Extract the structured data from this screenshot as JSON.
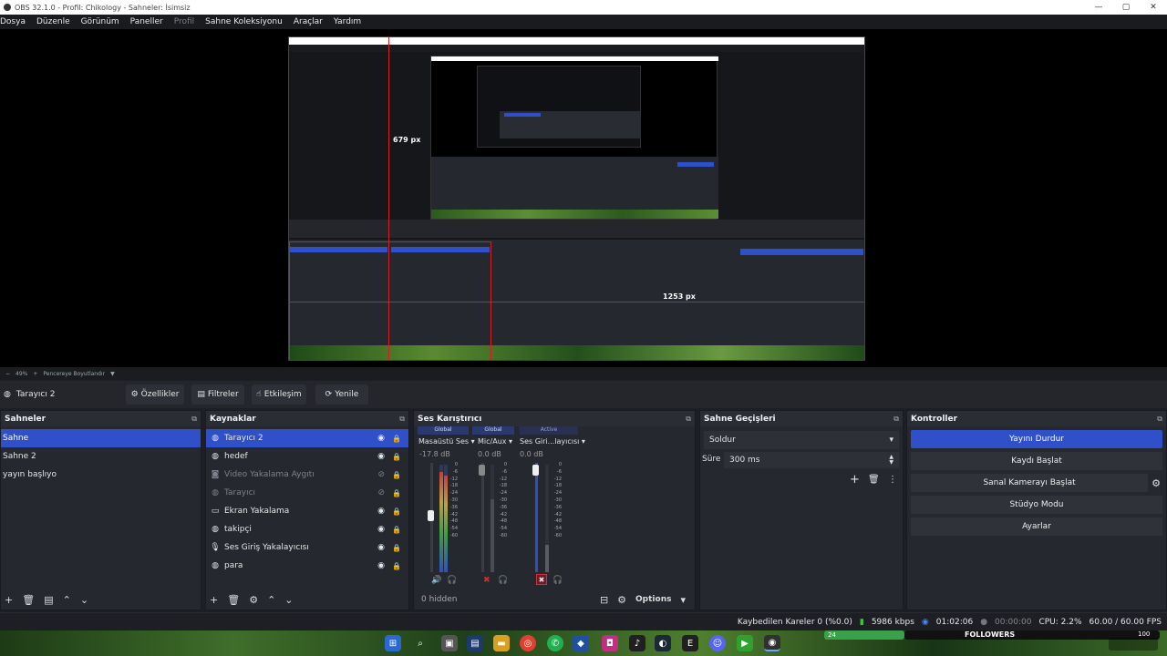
{
  "window": {
    "title": "OBS 32.1.0 - Profil: Chikology - Sahneler: İsimsiz",
    "controls": [
      "—",
      "▢",
      "✕"
    ]
  },
  "menu": [
    "Dosya",
    "Düzenle",
    "Görünüm",
    "Paneller",
    "Profil",
    "Sahne Koleksiyonu",
    "Araçlar",
    "Yardım"
  ],
  "preview": {
    "measure_vertical": "679 px",
    "measure_horizontal": "1253 px"
  },
  "zoombar": {
    "zoom": "49%",
    "add": "+",
    "mode": "Pencereye Boyutlandır"
  },
  "source_toolbar": {
    "selected_source": "Tarayıcı 2",
    "buttons": [
      "Özellikler",
      "Filtreler",
      "Etkileşim",
      "Yenile"
    ]
  },
  "scenes": {
    "title": "Sahneler",
    "items": [
      "Sahne",
      "Sahne 2",
      "yayın başlıyo"
    ],
    "selected": "Sahne"
  },
  "sources": {
    "title": "Kaynaklar",
    "items": [
      {
        "label": "Tarayıcı 2",
        "icon": "globe-icon",
        "visible": true
      },
      {
        "label": "hedef",
        "icon": "globe-icon",
        "visible": true
      },
      {
        "label": "Video Yakalama Aygıtı",
        "icon": "camera-icon",
        "visible": false
      },
      {
        "label": "Tarayıcı",
        "icon": "globe-icon",
        "visible": false
      },
      {
        "label": "Ekran Yakalama",
        "icon": "monitor-icon",
        "visible": true
      },
      {
        "label": "takipçi",
        "icon": "globe-icon",
        "visible": true
      },
      {
        "label": "Ses Giriş Yakalayıcısı",
        "icon": "mic-icon",
        "visible": true
      },
      {
        "label": "para",
        "icon": "globe-icon",
        "visible": true
      }
    ]
  },
  "mixer": {
    "title": "Ses Karıştırıcı",
    "channels": [
      {
        "badge": "Global",
        "name": "Masaüstü Ses",
        "db": "-17.8 dB"
      },
      {
        "badge": "Global",
        "name": "Mic/Aux",
        "db": "0.0 dB"
      },
      {
        "badge": "Active",
        "name": "Ses Giri...layıcısı",
        "db": "0.0 dB"
      }
    ],
    "scale": [
      "0",
      "-6",
      "-12",
      "-18",
      "-24",
      "-30",
      "-36",
      "-42",
      "-48",
      "-54",
      "-60"
    ],
    "hidden": "0 hidden",
    "options": "Options"
  },
  "transitions": {
    "title": "Sahne Geçişleri",
    "selected": "Soldur",
    "duration_label": "Süre",
    "duration": "300 ms"
  },
  "controls": {
    "title": "Kontroller",
    "buttons": [
      "Yayını Durdur",
      "Kaydı Başlat",
      "Sanal Kamerayı Başlat",
      "Stüdyo Modu",
      "Ayarlar"
    ]
  },
  "status": {
    "dropped": "Kaybedilen Kareler 0 (%0.0)",
    "bitrate": "5986 kbps",
    "stream_time": "01:02:06",
    "rec_time": "00:00:00",
    "cpu": "CPU: 2.2%",
    "fps": "60.00 / 60.00 FPS"
  },
  "taskbar": {
    "followers_label": "FOLLOWERS",
    "followers_count": "24",
    "followers_goal": "100"
  },
  "colors": {
    "accent": "#2f50c8",
    "panel": "#262830",
    "guide": "#d02020"
  }
}
